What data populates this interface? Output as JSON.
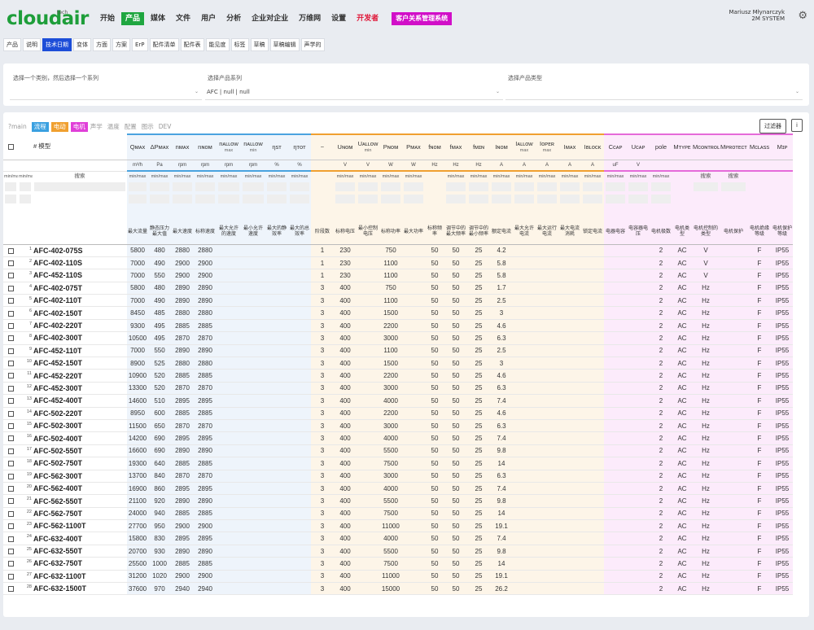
{
  "topnav": {
    "logo": "cloudair",
    "logo_sup": "tech",
    "menu": [
      {
        "label": "开始",
        "name": "nav-start",
        "state": ""
      },
      {
        "label": "产品",
        "name": "nav-products",
        "state": "active"
      },
      {
        "label": "媒体",
        "name": "nav-media",
        "state": ""
      },
      {
        "label": "文件",
        "name": "nav-files",
        "state": ""
      },
      {
        "label": "用户",
        "name": "nav-users",
        "state": ""
      },
      {
        "label": "分析",
        "name": "nav-analytics",
        "state": ""
      },
      {
        "label": "企业对企业",
        "name": "nav-b2b",
        "state": ""
      },
      {
        "label": "万维网",
        "name": "nav-www",
        "state": ""
      },
      {
        "label": "设置",
        "name": "nav-settings",
        "state": ""
      },
      {
        "label": "开发者",
        "name": "nav-developer",
        "state": "dev"
      },
      {
        "label": "客户关系管理系统",
        "name": "nav-crm",
        "state": "crm"
      }
    ],
    "user_name": "Mariusz Młynarczyk",
    "user_org": "2M SYSTEM",
    "settings_icon": "gear-icon"
  },
  "subtabs": [
    {
      "label": "产品",
      "active": false
    },
    {
      "label": "说明",
      "active": false
    },
    {
      "label": "技术日期",
      "active": true
    },
    {
      "label": "变体",
      "active": false
    },
    {
      "label": "方面",
      "active": false
    },
    {
      "label": "方案",
      "active": false
    },
    {
      "label": "ErP",
      "active": false
    },
    {
      "label": "配件清单",
      "active": false
    },
    {
      "label": "配件表",
      "active": false
    },
    {
      "label": "能见度",
      "active": false
    },
    {
      "label": "标签",
      "active": false
    },
    {
      "label": "草稿",
      "active": false
    },
    {
      "label": "草稿编辑",
      "active": false
    },
    {
      "label": "声学的",
      "active": false
    }
  ],
  "selector": {
    "category_label": "选择一个类别，然后选择一个系列",
    "series_label": "选择产品系列",
    "series_value": "AFC | null | null",
    "type_label": "选择产品类型",
    "arrow_icon": "chevron-down-icon"
  },
  "grouptabs": [
    {
      "label": "?main",
      "color": ""
    },
    {
      "label": "流程",
      "color": "#3aa0e0"
    },
    {
      "label": "电动",
      "color": "#f0a030"
    },
    {
      "label": "电机",
      "color": "#e040d8"
    },
    {
      "label": "声学",
      "color": ""
    },
    {
      "label": "温度",
      "color": ""
    },
    {
      "label": "配置",
      "color": ""
    },
    {
      "label": "图示",
      "color": ""
    },
    {
      "label": "DEV",
      "color": ""
    }
  ],
  "toolbar": {
    "filter_label": "过滤器",
    "info_label": "i"
  },
  "columns": [
    {
      "key": "cb",
      "w": 18,
      "g": "g0",
      "sym": "☐",
      "sub": "",
      "unit": "",
      "mm": "min/max",
      "zh": "",
      "srch": false
    },
    {
      "key": "idx",
      "w": 18,
      "g": "g0",
      "sym": "",
      "sub": "",
      "unit": "",
      "mm": "min/max",
      "zh": "",
      "srch": false
    },
    {
      "key": "name",
      "w": 116,
      "g": "g0",
      "sym": "# 模型",
      "sub": "",
      "unit": "",
      "mm": "",
      "zh": "",
      "srch": true
    },
    {
      "key": "qmax",
      "w": 26,
      "g": "g1",
      "sym": "Qᴍᴀx",
      "sub": "",
      "unit": "m³/h",
      "mm": "min/max",
      "zh": "最大流量",
      "srch": false
    },
    {
      "key": "dp",
      "w": 28,
      "g": "g1",
      "sym": "ΔPᴍᴀx",
      "sub": "",
      "unit": "Pa",
      "mm": "min/max",
      "zh": "静态压力最大值",
      "srch": false
    },
    {
      "key": "nmax",
      "w": 28,
      "g": "g1",
      "sym": "nᴍᴀx",
      "sub": "",
      "unit": "rpm",
      "mm": "min/max",
      "zh": "最大速度",
      "srch": false
    },
    {
      "key": "nnom",
      "w": 28,
      "g": "g1",
      "sym": "nɴᴏᴍ",
      "sub": "",
      "unit": "rpm",
      "mm": "min/max",
      "zh": "标称速度",
      "srch": false
    },
    {
      "key": "nallowmax",
      "w": 30,
      "g": "g1",
      "sym": "nᴀʟʟᴏᴡ",
      "sub": "max",
      "unit": "rpm",
      "mm": "min/max",
      "zh": "最大允许的速度",
      "srch": false
    },
    {
      "key": "nallowmin",
      "w": 30,
      "g": "g1",
      "sym": "nᴀʟʟᴏᴡ",
      "sub": "min",
      "unit": "rpm",
      "mm": "min/max",
      "zh": "最小允许速度",
      "srch": false
    },
    {
      "key": "nst",
      "w": 28,
      "g": "g1",
      "sym": "ηsт",
      "sub": "",
      "unit": "%",
      "mm": "min/max",
      "zh": "最大的静效率",
      "srch": false
    },
    {
      "key": "ntot",
      "w": 28,
      "g": "g1",
      "sym": "ηтᴏт",
      "sub": "",
      "unit": "%",
      "mm": "min/max",
      "zh": "最大的总效率",
      "srch": false
    },
    {
      "key": "phase",
      "w": 28,
      "g": "g2",
      "sym": "~",
      "sub": "",
      "unit": "",
      "mm": "",
      "zh": "阶段数",
      "srch": false
    },
    {
      "key": "unom",
      "w": 28,
      "g": "g2",
      "sym": "Uɴᴏᴍ",
      "sub": "",
      "unit": "V",
      "mm": "min/max",
      "zh": "标称电压",
      "srch": false
    },
    {
      "key": "uallowmin",
      "w": 28,
      "g": "g2",
      "sym": "Uᴀʟʟᴏᴡ",
      "sub": "min",
      "unit": "V",
      "mm": "min/max",
      "zh": "最小控制电压",
      "srch": false
    },
    {
      "key": "pnom",
      "w": 28,
      "g": "g2",
      "sym": "Pɴᴏᴍ",
      "sub": "",
      "unit": "W",
      "mm": "min/max",
      "zh": "标称功率",
      "srch": false
    },
    {
      "key": "pmax",
      "w": 28,
      "g": "g2",
      "sym": "Pᴍᴀx",
      "sub": "",
      "unit": "W",
      "mm": "min/max",
      "zh": "最大功率",
      "srch": false
    },
    {
      "key": "fnom",
      "w": 24,
      "g": "g2",
      "sym": "fɴᴏᴍ",
      "sub": "",
      "unit": "Hz",
      "mm": "",
      "zh": "标称频率",
      "srch": false
    },
    {
      "key": "fmax",
      "w": 28,
      "g": "g2",
      "sym": "fᴍᴀx",
      "sub": "",
      "unit": "Hz",
      "mm": "min/max",
      "zh": "调节中的最大频率",
      "srch": false
    },
    {
      "key": "fmin",
      "w": 28,
      "g": "g2",
      "sym": "fᴍɪɴ",
      "sub": "",
      "unit": "Hz",
      "mm": "min/max",
      "zh": "调节中的最小频率",
      "srch": false
    },
    {
      "key": "inom",
      "w": 28,
      "g": "g2",
      "sym": "Iɴᴏᴍ",
      "sub": "",
      "unit": "A",
      "mm": "min/max",
      "zh": "额定电流",
      "srch": false
    },
    {
      "key": "iallowmax",
      "w": 28,
      "g": "g2",
      "sym": "Iᴀʟʟᴏᴡ",
      "sub": "max",
      "unit": "A",
      "mm": "min/max",
      "zh": "最大允许电流",
      "srch": false
    },
    {
      "key": "iopermax",
      "w": 28,
      "g": "g2",
      "sym": "Iᴏᴘᴇʀ",
      "sub": "max",
      "unit": "A",
      "mm": "min/max",
      "zh": "最大运行电流",
      "srch": false
    },
    {
      "key": "imax",
      "w": 28,
      "g": "g2",
      "sym": "Iᴍᴀx",
      "sub": "",
      "unit": "A",
      "mm": "min/max",
      "zh": "最大电流消耗",
      "srch": false
    },
    {
      "key": "iblock",
      "w": 28,
      "g": "g2",
      "sym": "Iʙʟᴏᴄᴋ",
      "sub": "",
      "unit": "A",
      "mm": "min/max",
      "zh": "锁定电流",
      "srch": false
    },
    {
      "key": "ccap",
      "w": 28,
      "g": "g3",
      "sym": "Cᴄᴀᴘ",
      "sub": "",
      "unit": "uF",
      "mm": "min/max",
      "zh": "电器电容",
      "srch": false
    },
    {
      "key": "ucap",
      "w": 28,
      "g": "g3",
      "sym": "Uᴄᴀᴘ",
      "sub": "",
      "unit": "V",
      "mm": "min/max",
      "zh": "电容器电压",
      "srch": false
    },
    {
      "key": "pole",
      "w": 28,
      "g": "g3",
      "sym": "pole",
      "sub": "",
      "unit": "",
      "mm": "min/max",
      "zh": "电机极数",
      "srch": false
    },
    {
      "key": "mtype",
      "w": 24,
      "g": "g3",
      "sym": "Mᴛʏᴘᴇ",
      "sub": "",
      "unit": "",
      "mm": "",
      "zh": "电机类型",
      "srch": false
    },
    {
      "key": "mcontrol",
      "w": 34,
      "g": "g3",
      "sym": "Mᴄᴏɴᴛʀᴏʟ",
      "sub": "",
      "unit": "",
      "mm": "",
      "zh": "电机控制的类型",
      "srch": true
    },
    {
      "key": "mprotect",
      "w": 34,
      "g": "g3",
      "sym": "Mᴘʀᴏᴛᴇᴄᴛ",
      "sub": "",
      "unit": "",
      "mm": "",
      "zh": "电机保护",
      "srch": true
    },
    {
      "key": "mclass",
      "w": 30,
      "g": "g3",
      "sym": "Mᴄʟᴀss",
      "sub": "",
      "unit": "",
      "mm": "",
      "zh": "电机绝缘等级",
      "srch": false
    },
    {
      "key": "mip",
      "w": 26,
      "g": "g3",
      "sym": "Mɪᴘ",
      "sub": "",
      "unit": "",
      "mm": "",
      "zh": "电机保护等级",
      "srch": false
    }
  ],
  "search_label": "搜索",
  "mm_label": "min/max",
  "rows": [
    {
      "i": "1",
      "name": "AFC-402-075S",
      "q": "5800",
      "dp": "480",
      "nmax": "2880",
      "nnom": "2880",
      "ph": "1",
      "u": "230",
      "p": "750",
      "f": "50",
      "fmax": "50",
      "fmin": "25",
      "inom": "4.2",
      "pole": "2",
      "mt": "AC",
      "mc": "V",
      "cl": "F",
      "ip": "IP55"
    },
    {
      "i": "2",
      "name": "AFC-402-110S",
      "q": "7000",
      "dp": "490",
      "nmax": "2900",
      "nnom": "2900",
      "ph": "1",
      "u": "230",
      "p": "1100",
      "f": "50",
      "fmax": "50",
      "fmin": "25",
      "inom": "5.8",
      "pole": "2",
      "mt": "AC",
      "mc": "V",
      "cl": "F",
      "ip": "IP55"
    },
    {
      "i": "3",
      "name": "AFC-452-110S",
      "q": "7000",
      "dp": "550",
      "nmax": "2900",
      "nnom": "2900",
      "ph": "1",
      "u": "230",
      "p": "1100",
      "f": "50",
      "fmax": "50",
      "fmin": "25",
      "inom": "5.8",
      "pole": "2",
      "mt": "AC",
      "mc": "V",
      "cl": "F",
      "ip": "IP55"
    },
    {
      "i": "4",
      "name": "AFC-402-075T",
      "q": "5800",
      "dp": "480",
      "nmax": "2890",
      "nnom": "2890",
      "ph": "3",
      "u": "400",
      "p": "750",
      "f": "50",
      "fmax": "50",
      "fmin": "25",
      "inom": "1.7",
      "pole": "2",
      "mt": "AC",
      "mc": "Hz",
      "cl": "F",
      "ip": "IP55"
    },
    {
      "i": "5",
      "name": "AFC-402-110T",
      "q": "7000",
      "dp": "490",
      "nmax": "2890",
      "nnom": "2890",
      "ph": "3",
      "u": "400",
      "p": "1100",
      "f": "50",
      "fmax": "50",
      "fmin": "25",
      "inom": "2.5",
      "pole": "2",
      "mt": "AC",
      "mc": "Hz",
      "cl": "F",
      "ip": "IP55"
    },
    {
      "i": "6",
      "name": "AFC-402-150T",
      "q": "8450",
      "dp": "485",
      "nmax": "2880",
      "nnom": "2880",
      "ph": "3",
      "u": "400",
      "p": "1500",
      "f": "50",
      "fmax": "50",
      "fmin": "25",
      "inom": "3",
      "pole": "2",
      "mt": "AC",
      "mc": "Hz",
      "cl": "F",
      "ip": "IP55"
    },
    {
      "i": "7",
      "name": "AFC-402-220T",
      "q": "9300",
      "dp": "495",
      "nmax": "2885",
      "nnom": "2885",
      "ph": "3",
      "u": "400",
      "p": "2200",
      "f": "50",
      "fmax": "50",
      "fmin": "25",
      "inom": "4.6",
      "pole": "2",
      "mt": "AC",
      "mc": "Hz",
      "cl": "F",
      "ip": "IP55"
    },
    {
      "i": "8",
      "name": "AFC-402-300T",
      "q": "10500",
      "dp": "495",
      "nmax": "2870",
      "nnom": "2870",
      "ph": "3",
      "u": "400",
      "p": "3000",
      "f": "50",
      "fmax": "50",
      "fmin": "25",
      "inom": "6.3",
      "pole": "2",
      "mt": "AC",
      "mc": "Hz",
      "cl": "F",
      "ip": "IP55"
    },
    {
      "i": "9",
      "name": "AFC-452-110T",
      "q": "7000",
      "dp": "550",
      "nmax": "2890",
      "nnom": "2890",
      "ph": "3",
      "u": "400",
      "p": "1100",
      "f": "50",
      "fmax": "50",
      "fmin": "25",
      "inom": "2.5",
      "pole": "2",
      "mt": "AC",
      "mc": "Hz",
      "cl": "F",
      "ip": "IP55"
    },
    {
      "i": "10",
      "name": "AFC-452-150T",
      "q": "8900",
      "dp": "525",
      "nmax": "2880",
      "nnom": "2880",
      "ph": "3",
      "u": "400",
      "p": "1500",
      "f": "50",
      "fmax": "50",
      "fmin": "25",
      "inom": "3",
      "pole": "2",
      "mt": "AC",
      "mc": "Hz",
      "cl": "F",
      "ip": "IP55"
    },
    {
      "i": "11",
      "name": "AFC-452-220T",
      "q": "10900",
      "dp": "520",
      "nmax": "2885",
      "nnom": "2885",
      "ph": "3",
      "u": "400",
      "p": "2200",
      "f": "50",
      "fmax": "50",
      "fmin": "25",
      "inom": "4.6",
      "pole": "2",
      "mt": "AC",
      "mc": "Hz",
      "cl": "F",
      "ip": "IP55"
    },
    {
      "i": "12",
      "name": "AFC-452-300T",
      "q": "13300",
      "dp": "520",
      "nmax": "2870",
      "nnom": "2870",
      "ph": "3",
      "u": "400",
      "p": "3000",
      "f": "50",
      "fmax": "50",
      "fmin": "25",
      "inom": "6.3",
      "pole": "2",
      "mt": "AC",
      "mc": "Hz",
      "cl": "F",
      "ip": "IP55"
    },
    {
      "i": "13",
      "name": "AFC-452-400T",
      "q": "14600",
      "dp": "510",
      "nmax": "2895",
      "nnom": "2895",
      "ph": "3",
      "u": "400",
      "p": "4000",
      "f": "50",
      "fmax": "50",
      "fmin": "25",
      "inom": "7.4",
      "pole": "2",
      "mt": "AC",
      "mc": "Hz",
      "cl": "F",
      "ip": "IP55"
    },
    {
      "i": "14",
      "name": "AFC-502-220T",
      "q": "8950",
      "dp": "600",
      "nmax": "2885",
      "nnom": "2885",
      "ph": "3",
      "u": "400",
      "p": "2200",
      "f": "50",
      "fmax": "50",
      "fmin": "25",
      "inom": "4.6",
      "pole": "2",
      "mt": "AC",
      "mc": "Hz",
      "cl": "F",
      "ip": "IP55"
    },
    {
      "i": "15",
      "name": "AFC-502-300T",
      "q": "11500",
      "dp": "650",
      "nmax": "2870",
      "nnom": "2870",
      "ph": "3",
      "u": "400",
      "p": "3000",
      "f": "50",
      "fmax": "50",
      "fmin": "25",
      "inom": "6.3",
      "pole": "2",
      "mt": "AC",
      "mc": "Hz",
      "cl": "F",
      "ip": "IP55"
    },
    {
      "i": "16",
      "name": "AFC-502-400T",
      "q": "14200",
      "dp": "690",
      "nmax": "2895",
      "nnom": "2895",
      "ph": "3",
      "u": "400",
      "p": "4000",
      "f": "50",
      "fmax": "50",
      "fmin": "25",
      "inom": "7.4",
      "pole": "2",
      "mt": "AC",
      "mc": "Hz",
      "cl": "F",
      "ip": "IP55"
    },
    {
      "i": "17",
      "name": "AFC-502-550T",
      "q": "16600",
      "dp": "690",
      "nmax": "2890",
      "nnom": "2890",
      "ph": "3",
      "u": "400",
      "p": "5500",
      "f": "50",
      "fmax": "50",
      "fmin": "25",
      "inom": "9.8",
      "pole": "2",
      "mt": "AC",
      "mc": "Hz",
      "cl": "F",
      "ip": "IP55"
    },
    {
      "i": "18",
      "name": "AFC-502-750T",
      "q": "19300",
      "dp": "640",
      "nmax": "2885",
      "nnom": "2885",
      "ph": "3",
      "u": "400",
      "p": "7500",
      "f": "50",
      "fmax": "50",
      "fmin": "25",
      "inom": "14",
      "pole": "2",
      "mt": "AC",
      "mc": "Hz",
      "cl": "F",
      "ip": "IP55"
    },
    {
      "i": "19",
      "name": "AFC-562-300T",
      "q": "13700",
      "dp": "840",
      "nmax": "2870",
      "nnom": "2870",
      "ph": "3",
      "u": "400",
      "p": "3000",
      "f": "50",
      "fmax": "50",
      "fmin": "25",
      "inom": "6.3",
      "pole": "2",
      "mt": "AC",
      "mc": "Hz",
      "cl": "F",
      "ip": "IP55"
    },
    {
      "i": "20",
      "name": "AFC-562-400T",
      "q": "16900",
      "dp": "860",
      "nmax": "2895",
      "nnom": "2895",
      "ph": "3",
      "u": "400",
      "p": "4000",
      "f": "50",
      "fmax": "50",
      "fmin": "25",
      "inom": "7.4",
      "pole": "2",
      "mt": "AC",
      "mc": "Hz",
      "cl": "F",
      "ip": "IP55"
    },
    {
      "i": "21",
      "name": "AFC-562-550T",
      "q": "21100",
      "dp": "920",
      "nmax": "2890",
      "nnom": "2890",
      "ph": "3",
      "u": "400",
      "p": "5500",
      "f": "50",
      "fmax": "50",
      "fmin": "25",
      "inom": "9.8",
      "pole": "2",
      "mt": "AC",
      "mc": "Hz",
      "cl": "F",
      "ip": "IP55"
    },
    {
      "i": "22",
      "name": "AFC-562-750T",
      "q": "24000",
      "dp": "940",
      "nmax": "2885",
      "nnom": "2885",
      "ph": "3",
      "u": "400",
      "p": "7500",
      "f": "50",
      "fmax": "50",
      "fmin": "25",
      "inom": "14",
      "pole": "2",
      "mt": "AC",
      "mc": "Hz",
      "cl": "F",
      "ip": "IP55"
    },
    {
      "i": "23",
      "name": "AFC-562-1100T",
      "q": "27700",
      "dp": "950",
      "nmax": "2900",
      "nnom": "2900",
      "ph": "3",
      "u": "400",
      "p": "11000",
      "f": "50",
      "fmax": "50",
      "fmin": "25",
      "inom": "19.1",
      "pole": "2",
      "mt": "AC",
      "mc": "Hz",
      "cl": "F",
      "ip": "IP55"
    },
    {
      "i": "24",
      "name": "AFC-632-400T",
      "q": "15800",
      "dp": "830",
      "nmax": "2895",
      "nnom": "2895",
      "ph": "3",
      "u": "400",
      "p": "4000",
      "f": "50",
      "fmax": "50",
      "fmin": "25",
      "inom": "7.4",
      "pole": "2",
      "mt": "AC",
      "mc": "Hz",
      "cl": "F",
      "ip": "IP55"
    },
    {
      "i": "25",
      "name": "AFC-632-550T",
      "q": "20700",
      "dp": "930",
      "nmax": "2890",
      "nnom": "2890",
      "ph": "3",
      "u": "400",
      "p": "5500",
      "f": "50",
      "fmax": "50",
      "fmin": "25",
      "inom": "9.8",
      "pole": "2",
      "mt": "AC",
      "mc": "Hz",
      "cl": "F",
      "ip": "IP55"
    },
    {
      "i": "26",
      "name": "AFC-632-750T",
      "q": "25500",
      "dp": "1000",
      "nmax": "2885",
      "nnom": "2885",
      "ph": "3",
      "u": "400",
      "p": "7500",
      "f": "50",
      "fmax": "50",
      "fmin": "25",
      "inom": "14",
      "pole": "2",
      "mt": "AC",
      "mc": "Hz",
      "cl": "F",
      "ip": "IP55"
    },
    {
      "i": "27",
      "name": "AFC-632-1100T",
      "q": "31200",
      "dp": "1020",
      "nmax": "2900",
      "nnom": "2900",
      "ph": "3",
      "u": "400",
      "p": "11000",
      "f": "50",
      "fmax": "50",
      "fmin": "25",
      "inom": "19.1",
      "pole": "2",
      "mt": "AC",
      "mc": "Hz",
      "cl": "F",
      "ip": "IP55"
    },
    {
      "i": "28",
      "name": "AFC-632-1500T",
      "q": "37600",
      "dp": "970",
      "nmax": "2940",
      "nnom": "2940",
      "ph": "3",
      "u": "400",
      "p": "15000",
      "f": "50",
      "fmax": "50",
      "fmin": "25",
      "inom": "26.2",
      "pole": "2",
      "mt": "AC",
      "mc": "Hz",
      "cl": "F",
      "ip": "IP55"
    }
  ]
}
